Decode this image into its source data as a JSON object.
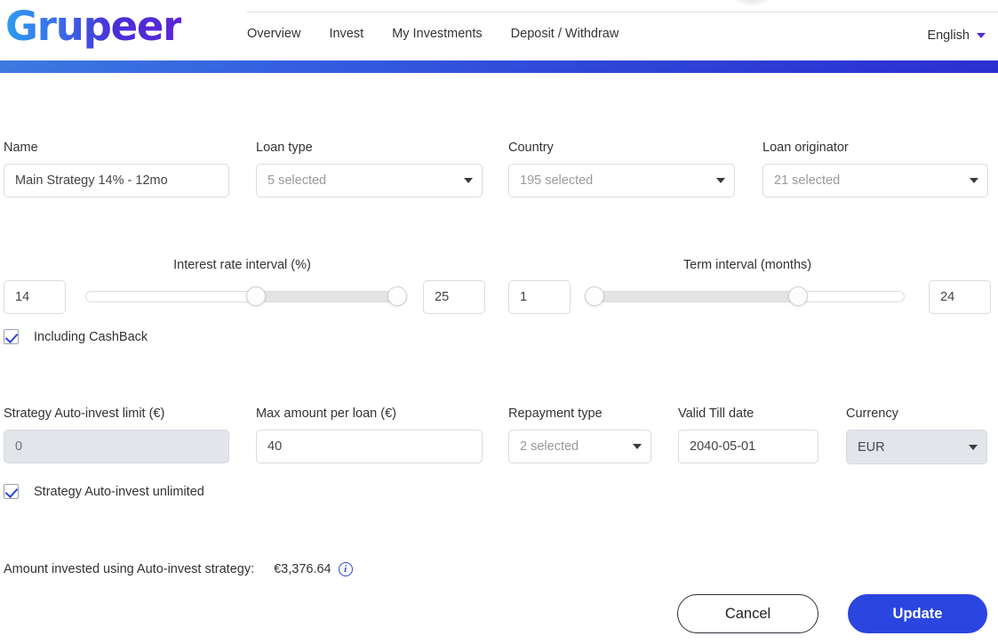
{
  "brand": {
    "name": "Grupeer"
  },
  "nav": {
    "items": [
      {
        "label": "Overview"
      },
      {
        "label": "Invest"
      },
      {
        "label": "My Investments"
      },
      {
        "label": "Deposit / Withdraw"
      }
    ],
    "language": "English"
  },
  "form": {
    "name": {
      "label": "Name",
      "value": "Main Strategy 14% - 12mo"
    },
    "loan_type": {
      "label": "Loan type",
      "value": "5 selected"
    },
    "country": {
      "label": "Country",
      "value": "195 selected"
    },
    "loan_originator": {
      "label": "Loan originator",
      "value": "21 selected"
    },
    "interest_interval": {
      "label": "Interest rate interval (%)",
      "min_value": "14",
      "max_value": "25"
    },
    "term_interval": {
      "label": "Term interval (months)",
      "min_value": "1",
      "max_value": "24"
    },
    "including_cashback": {
      "label": "Including CashBack",
      "checked": true
    },
    "auto_invest_limit": {
      "label": "Strategy Auto-invest limit (€)",
      "value": "0"
    },
    "max_amount_per_loan": {
      "label": "Max amount per loan (€)",
      "value": "40"
    },
    "repayment_type": {
      "label": "Repayment type",
      "value": "2 selected"
    },
    "valid_till": {
      "label": "Valid Till date",
      "value": "2040-05-01"
    },
    "currency": {
      "label": "Currency",
      "value": "EUR"
    },
    "auto_invest_unlimited": {
      "label": "Strategy Auto-invest unlimited",
      "checked": true
    }
  },
  "footer": {
    "invested_label": "Amount invested using Auto-invest strategy:",
    "invested_amount": "€3,376.64",
    "info_glyph": "i",
    "cancel_label": "Cancel",
    "update_label": "Update"
  },
  "colors": {
    "accent": "#2b46e0",
    "logo_start": "#2e9cf0",
    "logo_end": "#5a26d6",
    "bar_start": "#3c7ae0",
    "bar_end": "#2b2fd0"
  }
}
